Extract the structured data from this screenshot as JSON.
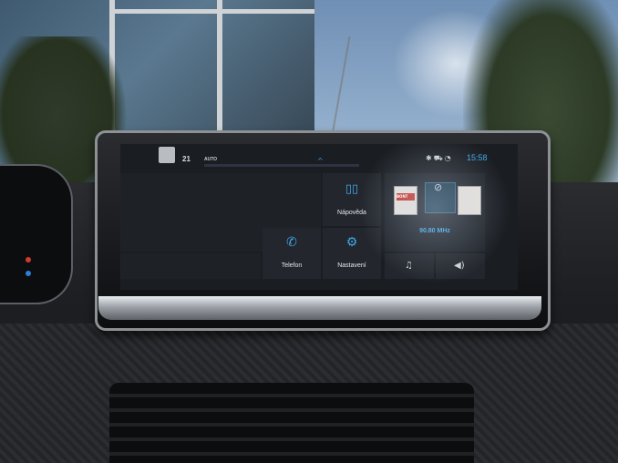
{
  "status_bar": {
    "temperature": "21",
    "climate_mode": "AUTO",
    "chevron": "^",
    "clock": "15:58",
    "icons": [
      "bluetooth-icon",
      "car-icon",
      "signal-icon"
    ]
  },
  "tiles": {
    "help_label": "Nápověda",
    "phone_label": "Telefon",
    "settings_label": "Nastavení"
  },
  "radio": {
    "frequency": "90.80 MHz",
    "station_left_logo": "BONT",
    "muted": true
  },
  "colors": {
    "accent": "#3fa7ea",
    "screen_bg": "#1a1d22",
    "tile_bg": "#23272d"
  }
}
